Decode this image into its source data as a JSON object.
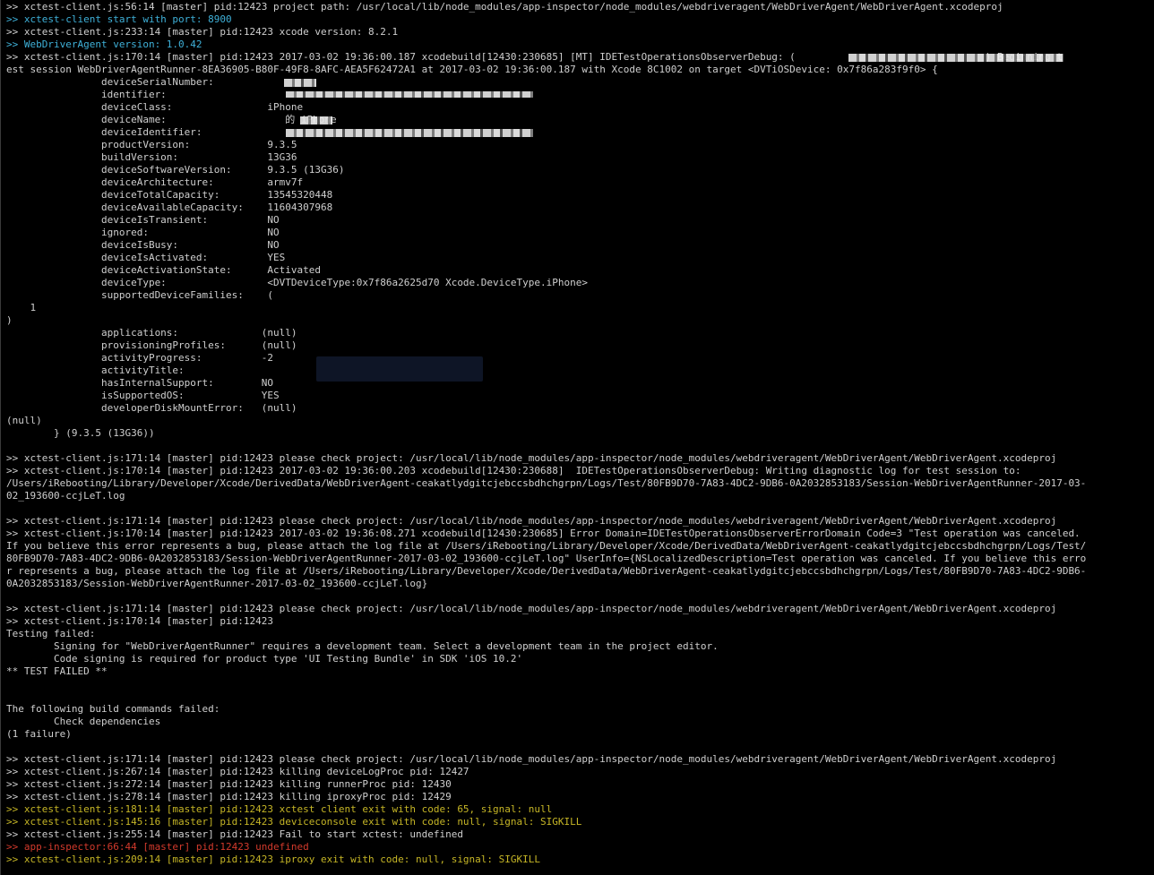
{
  "window": {
    "background": "#000000",
    "text_color": "#cfcfcf",
    "info_color": "#3fb1d9",
    "warn_color": "#c6b626",
    "error_color": "#d33a2c"
  },
  "lines": [
    {
      "type": "norm",
      "text": ">> xctest-client.js:56:14 [master] pid:12423 project path: /usr/local/lib/node_modules/app-inspector/node_modules/webdriveragent/WebDriverAgent/WebDriverAgent.xcodeproj"
    },
    {
      "type": "info",
      "text": ">> xctest-client start with port: 8900"
    },
    {
      "type": "norm",
      "text": ">> xctest-client.js:233:14 [master] pid:12423 xcode version: 8.2.1"
    },
    {
      "type": "info",
      "text": ">> WebDriverAgent version: 1.0.42"
    },
    {
      "type": "norm",
      "text": ">> xctest-client.js:170:14 [master] pid:12423 2017-03-02 19:36:00.187 xcodebuild[12430:230685] [MT] IDETestOperationsObserverDebug: (                                ) Beginning t"
    },
    {
      "type": "norm",
      "text": "est session WebDriverAgentRunner-8EA36905-B80F-49F8-8AFC-AEA5F62472A1 at 2017-03-02 19:36:00.187 with Xcode 8C1002 on target <DVTiOSDevice: 0x7f86a283f9f0> {"
    },
    {
      "type": "norm",
      "text": "                deviceSerialNumber:"
    },
    {
      "type": "norm",
      "text": "                identifier:"
    },
    {
      "type": "norm",
      "text": "                deviceClass:                iPhone"
    },
    {
      "type": "norm",
      "text": "                deviceName:                    的 iPhone"
    },
    {
      "type": "norm",
      "text": "                deviceIdentifier:"
    },
    {
      "type": "norm",
      "text": "                productVersion:             9.3.5"
    },
    {
      "type": "norm",
      "text": "                buildVersion:               13G36"
    },
    {
      "type": "norm",
      "text": "                deviceSoftwareVersion:      9.3.5 (13G36)"
    },
    {
      "type": "norm",
      "text": "                deviceArchitecture:         armv7f"
    },
    {
      "type": "norm",
      "text": "                deviceTotalCapacity:        13545320448"
    },
    {
      "type": "norm",
      "text": "                deviceAvailableCapacity:    11604307968"
    },
    {
      "type": "norm",
      "text": "                deviceIsTransient:          NO"
    },
    {
      "type": "norm",
      "text": "                ignored:                    NO"
    },
    {
      "type": "norm",
      "text": "                deviceIsBusy:               NO"
    },
    {
      "type": "norm",
      "text": "                deviceIsActivated:          YES"
    },
    {
      "type": "norm",
      "text": "                deviceActivationState:      Activated"
    },
    {
      "type": "norm",
      "text": "                deviceType:                 <DVTDeviceType:0x7f86a2625d70 Xcode.DeviceType.iPhone>"
    },
    {
      "type": "norm",
      "text": "                supportedDeviceFamilies:    ("
    },
    {
      "type": "norm",
      "text": "    1"
    },
    {
      "type": "norm",
      "text": ")"
    },
    {
      "type": "norm",
      "text": "                applications:              (null)"
    },
    {
      "type": "norm",
      "text": "                provisioningProfiles:      (null)"
    },
    {
      "type": "norm",
      "text": "                activityProgress:          -2"
    },
    {
      "type": "norm",
      "text": "                activityTitle:"
    },
    {
      "type": "norm",
      "text": "                hasInternalSupport:        NO"
    },
    {
      "type": "norm",
      "text": "                isSupportedOS:             YES"
    },
    {
      "type": "norm",
      "text": "                developerDiskMountError:   (null)"
    },
    {
      "type": "norm",
      "text": "(null)"
    },
    {
      "type": "norm",
      "text": "        } (9.3.5 (13G36))"
    },
    {
      "type": "norm",
      "text": ""
    },
    {
      "type": "norm",
      "text": ">> xctest-client.js:171:14 [master] pid:12423 please check project: /usr/local/lib/node_modules/app-inspector/node_modules/webdriveragent/WebDriverAgent/WebDriverAgent.xcodeproj"
    },
    {
      "type": "norm",
      "text": ">> xctest-client.js:170:14 [master] pid:12423 2017-03-02 19:36:00.203 xcodebuild[12430:230688]  IDETestOperationsObserverDebug: Writing diagnostic log for test session to:"
    },
    {
      "type": "norm",
      "text": "/Users/iRebooting/Library/Developer/Xcode/DerivedData/WebDriverAgent-ceakatlydgitcjebccsbdhchgrpn/Logs/Test/80FB9D70-7A83-4DC2-9DB6-0A2032853183/Session-WebDriverAgentRunner-2017-03-"
    },
    {
      "type": "norm",
      "text": "02_193600-ccjLeT.log"
    },
    {
      "type": "norm",
      "text": ""
    },
    {
      "type": "norm",
      "text": ">> xctest-client.js:171:14 [master] pid:12423 please check project: /usr/local/lib/node_modules/app-inspector/node_modules/webdriveragent/WebDriverAgent/WebDriverAgent.xcodeproj"
    },
    {
      "type": "norm",
      "text": ">> xctest-client.js:170:14 [master] pid:12423 2017-03-02 19:36:08.271 xcodebuild[12430:230685] Error Domain=IDETestOperationsObserverErrorDomain Code=3 \"Test operation was canceled."
    },
    {
      "type": "norm",
      "text": "If you believe this error represents a bug, please attach the log file at /Users/iRebooting/Library/Developer/Xcode/DerivedData/WebDriverAgent-ceakatlydgitcjebccsbdhchgrpn/Logs/Test/"
    },
    {
      "type": "norm",
      "text": "80FB9D70-7A83-4DC2-9DB6-0A2032853183/Session-WebDriverAgentRunner-2017-03-02_193600-ccjLeT.log\" UserInfo={NSLocalizedDescription=Test operation was canceled. If you believe this erro"
    },
    {
      "type": "norm",
      "text": "r represents a bug, please attach the log file at /Users/iRebooting/Library/Developer/Xcode/DerivedData/WebDriverAgent-ceakatlydgitcjebccsbdhchgrpn/Logs/Test/80FB9D70-7A83-4DC2-9DB6-"
    },
    {
      "type": "norm",
      "text": "0A2032853183/Session-WebDriverAgentRunner-2017-03-02_193600-ccjLeT.log}"
    },
    {
      "type": "norm",
      "text": ""
    },
    {
      "type": "norm",
      "text": ">> xctest-client.js:171:14 [master] pid:12423 please check project: /usr/local/lib/node_modules/app-inspector/node_modules/webdriveragent/WebDriverAgent/WebDriverAgent.xcodeproj"
    },
    {
      "type": "norm",
      "text": ">> xctest-client.js:170:14 [master] pid:12423"
    },
    {
      "type": "norm",
      "text": "Testing failed:"
    },
    {
      "type": "norm",
      "text": "        Signing for \"WebDriverAgentRunner\" requires a development team. Select a development team in the project editor."
    },
    {
      "type": "norm",
      "text": "        Code signing is required for product type 'UI Testing Bundle' in SDK 'iOS 10.2'"
    },
    {
      "type": "norm",
      "text": "** TEST FAILED **"
    },
    {
      "type": "norm",
      "text": ""
    },
    {
      "type": "norm",
      "text": ""
    },
    {
      "type": "norm",
      "text": "The following build commands failed:"
    },
    {
      "type": "norm",
      "text": "        Check dependencies"
    },
    {
      "type": "norm",
      "text": "(1 failure)"
    },
    {
      "type": "norm",
      "text": ""
    },
    {
      "type": "norm",
      "text": ">> xctest-client.js:171:14 [master] pid:12423 please check project: /usr/local/lib/node_modules/app-inspector/node_modules/webdriveragent/WebDriverAgent/WebDriverAgent.xcodeproj"
    },
    {
      "type": "norm",
      "text": ">> xctest-client.js:267:14 [master] pid:12423 killing deviceLogProc pid: 12427"
    },
    {
      "type": "norm",
      "text": ">> xctest-client.js:272:14 [master] pid:12423 killing runnerProc pid: 12430"
    },
    {
      "type": "norm",
      "text": ">> xctest-client.js:278:14 [master] pid:12423 killing iproxyProc pid: 12429"
    },
    {
      "type": "warn",
      "text": ">> xctest-client.js:181:14 [master] pid:12423 xctest client exit with code: 65, signal: null"
    },
    {
      "type": "warn",
      "text": ">> xctest-client.js:145:16 [master] pid:12423 deviceconsole exit with code: null, signal: SIGKILL"
    },
    {
      "type": "norm",
      "text": ">> xctest-client.js:255:14 [master] pid:12423 Fail to start xctest: undefined"
    },
    {
      "type": "err",
      "text": ">> app-inspector:66:44 [master] pid:12423 undefined"
    },
    {
      "type": "warn",
      "text": ">> xctest-client.js:209:14 [master] pid:12423 iproxy exit with code: null, signal: SIGKILL"
    }
  ]
}
